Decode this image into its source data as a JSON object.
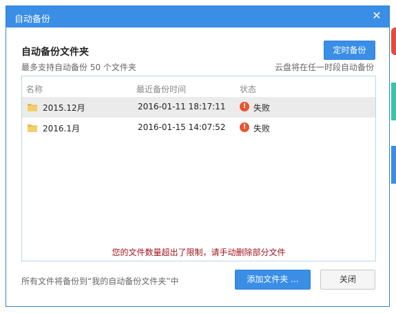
{
  "window": {
    "title": "自动备份"
  },
  "header": {
    "heading": "自动备份文件夹",
    "subtext_left": "最多支持自动备份 50 个文件夹",
    "subtext_right": "云盘将在任一时段自动备份",
    "schedule_button": "定时备份"
  },
  "list": {
    "columns": {
      "name": "名称",
      "time": "最近备份时间",
      "status": "状态"
    },
    "rows": [
      {
        "name": "2015.12月",
        "time": "2016-01-11 18:17:11",
        "status": "失败",
        "selected": true
      },
      {
        "name": "2016.1月",
        "time": "2016-01-15 14:07:52",
        "status": "失败",
        "selected": false
      }
    ],
    "warning": "您的文件数量超出了限制，请手动删除部分文件"
  },
  "footer": {
    "note": "所有文件将备份到“我的自动备份文件夹”中",
    "add_button": "添加文件夹 ...",
    "close_button": "关闭"
  },
  "colors": {
    "accent": "#3a8ee6",
    "error": "#e8552f",
    "warning_text": "#a0141e",
    "selected_row": "#ebebeb"
  },
  "icons": {
    "close": "close-icon",
    "folder": "folder-icon",
    "error": "error-icon"
  }
}
